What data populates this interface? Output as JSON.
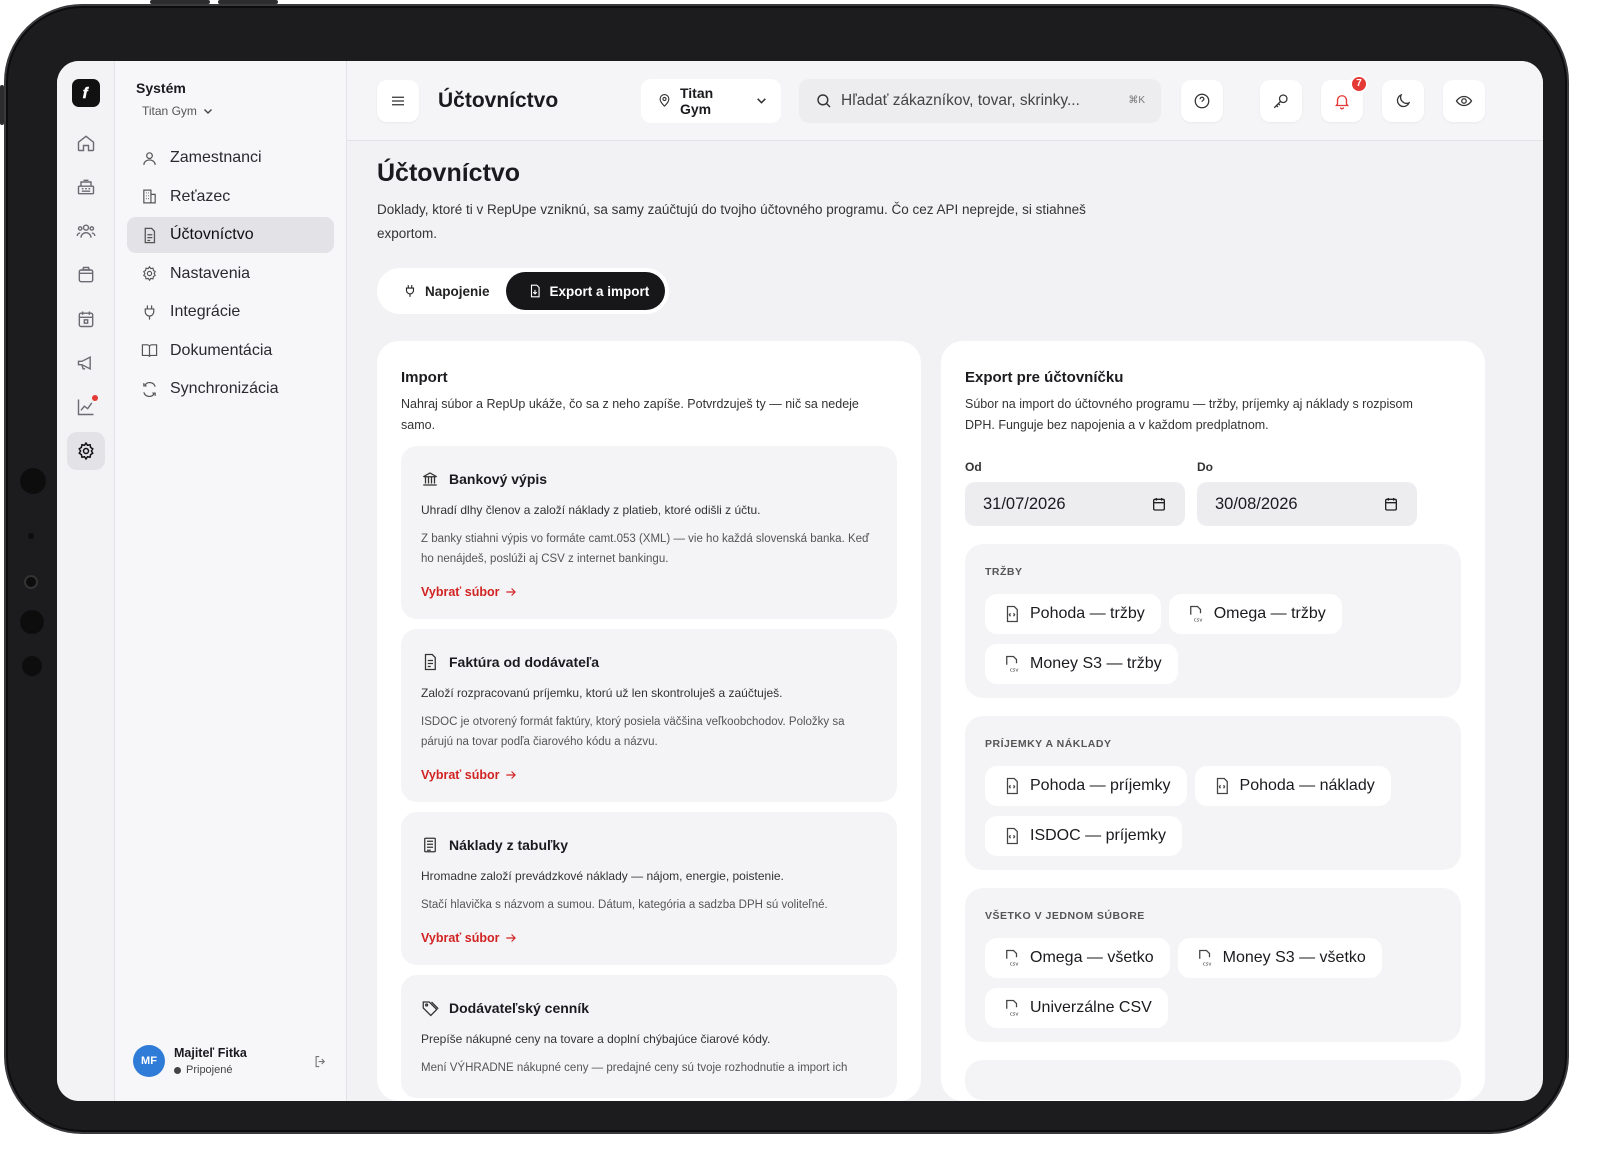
{
  "sidebar": {
    "system_title": "Systém",
    "org": "Titan Gym",
    "items": [
      {
        "label": "Zamestnanci",
        "icon": "person-icon"
      },
      {
        "label": "Reťazec",
        "icon": "building-icon"
      },
      {
        "label": "Účtovníctvo",
        "icon": "document-icon",
        "active": true
      },
      {
        "label": "Nastavenia",
        "icon": "gear-icon"
      },
      {
        "label": "Integrácie",
        "icon": "plug-icon"
      },
      {
        "label": "Dokumentácia",
        "icon": "book-icon"
      },
      {
        "label": "Synchronizácia",
        "icon": "sync-icon"
      }
    ],
    "user": {
      "initials": "MF",
      "name": "Majiteľ Fitka",
      "status": "Pripojené"
    }
  },
  "rail": {
    "icons": [
      "home-icon",
      "cash-register-icon",
      "users-icon",
      "box-icon",
      "calendar-icon",
      "megaphone-icon",
      "chart-icon",
      "settings-icon"
    ],
    "accent": "#e53935"
  },
  "topbar": {
    "title": "Účtovníctvo",
    "gym": "Titan Gym",
    "search_placeholder": "Hľadať zákazníkov, tovar, skrinky...",
    "search_kbd": "⌘K",
    "notif_count": "7"
  },
  "page": {
    "title": "Účtovníctvo",
    "description": "Doklady, ktoré ti v RepUpe vzniknú, sa samy zaúčtujú do tvojho účtovného programu. Čo cez API neprejde, si stiahneš exportom.",
    "tabs": [
      {
        "label": "Napojenie"
      },
      {
        "label": "Export a import",
        "active": true
      }
    ]
  },
  "import": {
    "title": "Import",
    "description": "Nahraj súbor a RepUp ukáže, čo sa z neho zapíše. Potvrdzuješ ty — nič sa nedeje samo.",
    "items": [
      {
        "title": "Bankový výpis",
        "text": "Uhradí dlhy členov a založí náklady z platieb, ktoré odišli z účtu.",
        "note": "Z banky stiahni výpis vo formáte camt.053 (XML) — vie ho každá slovenská banka. Keď ho nenájdeš, poslúži aj CSV z internet bankingu.",
        "link": "Vybrať súbor"
      },
      {
        "title": "Faktúra od dodávateľa",
        "text": "Založí rozpracovanú príjemku, ktorú už len skontroluješ a zaúčtuješ.",
        "note": "ISDOC je otvorený formát faktúry, ktorý posiela väčšina veľkoobchodov. Položky sa párujú na tovar podľa čiarového kódu a názvu.",
        "link": "Vybrať súbor"
      },
      {
        "title": "Náklady z tabuľky",
        "text": "Hromadne založí prevádzkové náklady — nájom, energie, poistenie.",
        "note": "Stačí hlavička s názvom a sumou. Dátum, kategória a sadzba DPH sú voliteľné.",
        "link": "Vybrať súbor"
      },
      {
        "title": "Dodávateľský cenník",
        "text": "Prepíše nákupné ceny na tovare a doplní chýbajúce čiarové kódy.",
        "note": "Mení VÝHRADNE nákupné ceny — predajné ceny sú tvoje rozhodnutie a import ich",
        "link": ""
      }
    ]
  },
  "export": {
    "title": "Export pre účtovníčku",
    "description": "Súbor na import do účtovného programu — tržby, príjemky aj náklady s rozpisom DPH. Funguje bez napojenia a v každom predplatnom.",
    "from_label": "Od",
    "from_value": "31/07/2026",
    "to_label": "Do",
    "to_value": "30/08/2026",
    "groups": [
      {
        "title": "TRŽBY",
        "chips": [
          {
            "label": "Pohoda — tržby",
            "icon": "xml-file-icon"
          },
          {
            "label": "Omega — tržby",
            "icon": "csv-file-icon"
          },
          {
            "label": "Money S3 — tržby",
            "icon": "csv-file-icon"
          }
        ]
      },
      {
        "title": "PRÍJEMKY A NÁKLADY",
        "chips": [
          {
            "label": "Pohoda — príjemky",
            "icon": "xml-file-icon"
          },
          {
            "label": "Pohoda — náklady",
            "icon": "xml-file-icon"
          },
          {
            "label": "ISDOC — príjemky",
            "icon": "xml-file-icon"
          }
        ]
      },
      {
        "title": "VŠETKO V JEDNOM SÚBORE",
        "chips": [
          {
            "label": "Omega — všetko",
            "icon": "csv-file-icon"
          },
          {
            "label": "Money S3 — všetko",
            "icon": "csv-file-icon"
          },
          {
            "label": "Univerzálne CSV",
            "icon": "csv-file-icon"
          }
        ]
      }
    ]
  }
}
